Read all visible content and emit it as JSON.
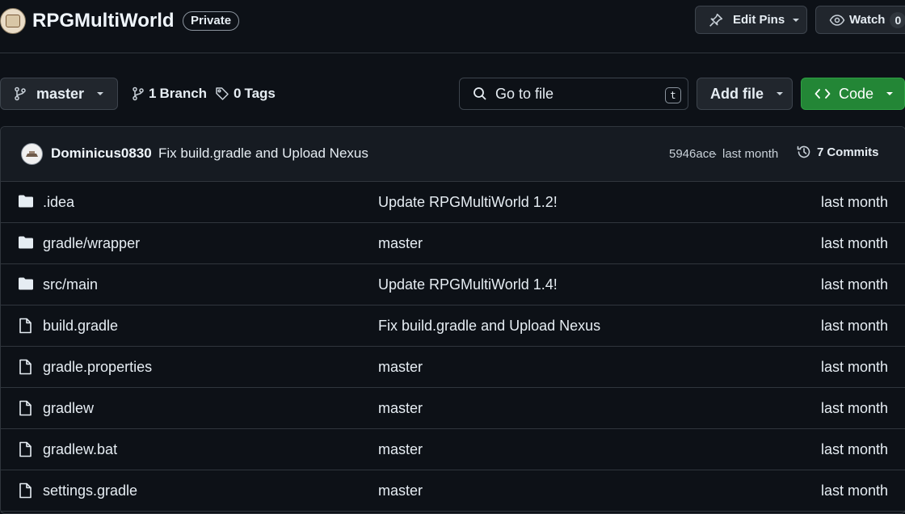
{
  "repo": {
    "name": "RPGMultiWorld",
    "visibility": "Private"
  },
  "header_actions": {
    "edit_pins_label": "Edit Pins",
    "watch_label": "Watch",
    "watch_count": "0"
  },
  "toolbar": {
    "branch": "master",
    "branch_count": "1",
    "branch_label": "Branch",
    "tag_count": "0",
    "tag_label": "Tags",
    "search_placeholder": "Go to file",
    "search_shortcut": "t",
    "add_file_label": "Add file",
    "code_label": "Code"
  },
  "latest_commit": {
    "author": "Dominicus0830",
    "message": "Fix build.gradle and Upload Nexus",
    "hash": "5946ace",
    "separator": "·",
    "time": "last month",
    "commits_count": "7",
    "commits_label": "Commits"
  },
  "files": [
    {
      "type": "folder",
      "icon": "folder-icon",
      "name": ".idea",
      "message": "Update RPGMultiWorld 1.2!",
      "time": "last month"
    },
    {
      "type": "folder",
      "icon": "folder-icon",
      "name": "gradle/wrapper",
      "message": "master",
      "time": "last month"
    },
    {
      "type": "folder",
      "icon": "folder-icon",
      "name": "src/main",
      "message": "Update RPGMultiWorld 1.4!",
      "time": "last month"
    },
    {
      "type": "file",
      "icon": "file-icon",
      "name": "build.gradle",
      "message": "Fix build.gradle and Upload Nexus",
      "time": "last month"
    },
    {
      "type": "file",
      "icon": "file-icon",
      "name": "gradle.properties",
      "message": "master",
      "time": "last month"
    },
    {
      "type": "file",
      "icon": "file-icon",
      "name": "gradlew",
      "message": "master",
      "time": "last month"
    },
    {
      "type": "file",
      "icon": "file-icon",
      "name": "gradlew.bat",
      "message": "master",
      "time": "last month"
    },
    {
      "type": "file",
      "icon": "file-icon",
      "name": "settings.gradle",
      "message": "master",
      "time": "last month"
    }
  ],
  "colors": {
    "background": "#0d1117",
    "surface": "#161b22",
    "border": "#30363d",
    "code_button": "#238636",
    "text": "#e6edf3",
    "muted": "#8b949e"
  }
}
